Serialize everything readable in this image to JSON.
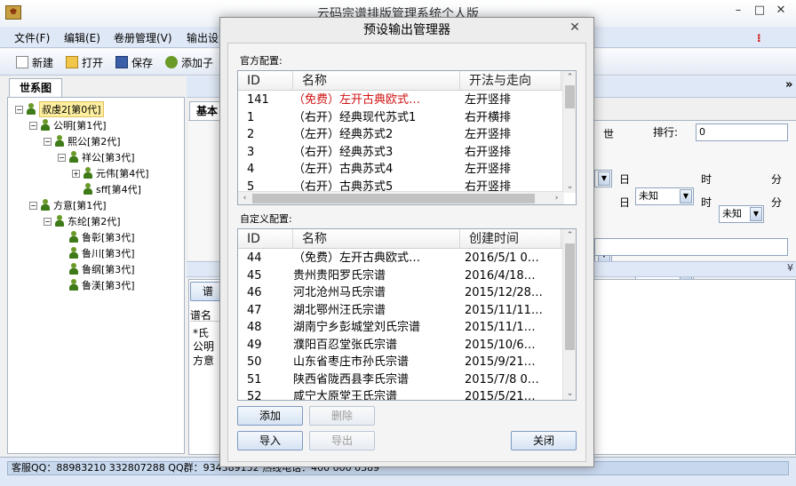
{
  "app": {
    "title": "云码宗谱排版管理系统个人版",
    "icon_glyph": "♚",
    "menu": [
      "文件(F)",
      "编辑(E)",
      "卷册管理(V)",
      "输出设"
    ],
    "toolbar": [
      "新建",
      "打开",
      "保存",
      "添加子"
    ],
    "window_buttons": [
      "–",
      "□",
      "✕"
    ],
    "menu_right_mark": "⁝"
  },
  "tree": {
    "tab": "世系图",
    "nodes": [
      {
        "label": "叔虔2[第0代]",
        "depth": 0,
        "box": "−",
        "selected": true
      },
      {
        "label": "公明[第1代]",
        "depth": 1,
        "box": "−"
      },
      {
        "label": "熙公[第2代]",
        "depth": 2,
        "box": "−"
      },
      {
        "label": "祥公[第3代]",
        "depth": 3,
        "box": "−"
      },
      {
        "label": "元伟[第4代]",
        "depth": 4,
        "box": "+"
      },
      {
        "label": "sff[第4代]",
        "depth": 4,
        "box": ""
      },
      {
        "label": "方意[第1代]",
        "depth": 1,
        "box": "−"
      },
      {
        "label": "东纶[第2代]",
        "depth": 2,
        "box": "−"
      },
      {
        "label": "鲁彰[第3代]",
        "depth": 3,
        "box": ""
      },
      {
        "label": "鲁川[第3代]",
        "depth": 3,
        "box": ""
      },
      {
        "label": "鲁纲[第3代]",
        "depth": 3,
        "box": ""
      },
      {
        "label": "鲁渼[第3代]",
        "depth": 3,
        "box": ""
      }
    ]
  },
  "main": {
    "basic_tab": "基本",
    "generation_suffix": "世",
    "rank_label": "排行:",
    "rank_value": "0",
    "day_label": "日",
    "hour_label": "时",
    "minute_label": "分",
    "unknown": "未知",
    "lower_tab": "谱",
    "lower_header": "谱名",
    "lower_rows": [
      "*氏",
      "公明",
      "方意"
    ],
    "collapse_glyph": "»",
    "expand_glyph": "¥"
  },
  "status": {
    "text": "客服QQ：88983210  332807288 QQ群：934389132   热线电话：400 000 0389"
  },
  "dialog": {
    "title": "预设输出管理器",
    "close": "✕",
    "official": {
      "label": "官方配置:",
      "columns": [
        "ID",
        "名称",
        "开法与走向"
      ],
      "rows": [
        {
          "id": "141",
          "name": "（免费）左开古典欧式…",
          "dir": "左开竖排",
          "red": true
        },
        {
          "id": "1",
          "name": "（右开）经典现代苏式1",
          "dir": "右开横排"
        },
        {
          "id": "2",
          "name": "（左开）经典苏式2",
          "dir": "左开竖排"
        },
        {
          "id": "3",
          "name": "（右开）经典苏式3",
          "dir": "右开竖排"
        },
        {
          "id": "4",
          "name": "（左开）古典苏式4",
          "dir": "左开竖排"
        },
        {
          "id": "5",
          "name": "（右开）古典苏式5",
          "dir": "右开竖排"
        }
      ]
    },
    "custom": {
      "label": "自定义配置:",
      "columns": [
        "ID",
        "名称",
        "创建时间"
      ],
      "rows": [
        {
          "id": "44",
          "name": "（免费）左开古典欧式…",
          "time": "2016/5/1  0…"
        },
        {
          "id": "45",
          "name": "贵州贵阳罗氏宗谱",
          "time": "2016/4/18…"
        },
        {
          "id": "46",
          "name": "河北沧州马氏宗谱",
          "time": "2015/12/28…"
        },
        {
          "id": "47",
          "name": "湖北鄂州汪氏宗谱",
          "time": "2015/11/11…"
        },
        {
          "id": "48",
          "name": "湖南宁乡彭城堂刘氏宗谱",
          "time": "2015/11/1…"
        },
        {
          "id": "49",
          "name": "濮阳百忍堂张氏宗谱",
          "time": "2015/10/6…"
        },
        {
          "id": "50",
          "name": "山东省枣庄市孙氏宗谱",
          "time": "2015/9/21…"
        },
        {
          "id": "51",
          "name": "陕西省陇西县李氏宗谱",
          "time": "2015/7/8  0…"
        },
        {
          "id": "52",
          "name": "咸宁大原堂王氏宗谱",
          "time": "2015/5/21…"
        }
      ]
    },
    "buttons": {
      "add": "添加",
      "delete": "删除",
      "import": "导入",
      "export": "导出",
      "close": "关闭"
    },
    "arrows": {
      "up": "⌃",
      "down": "⌄",
      "left": "‹",
      "right": "›"
    },
    "colors": {
      "free_red": "#d01010",
      "button_border": "#7d9ac2"
    }
  }
}
